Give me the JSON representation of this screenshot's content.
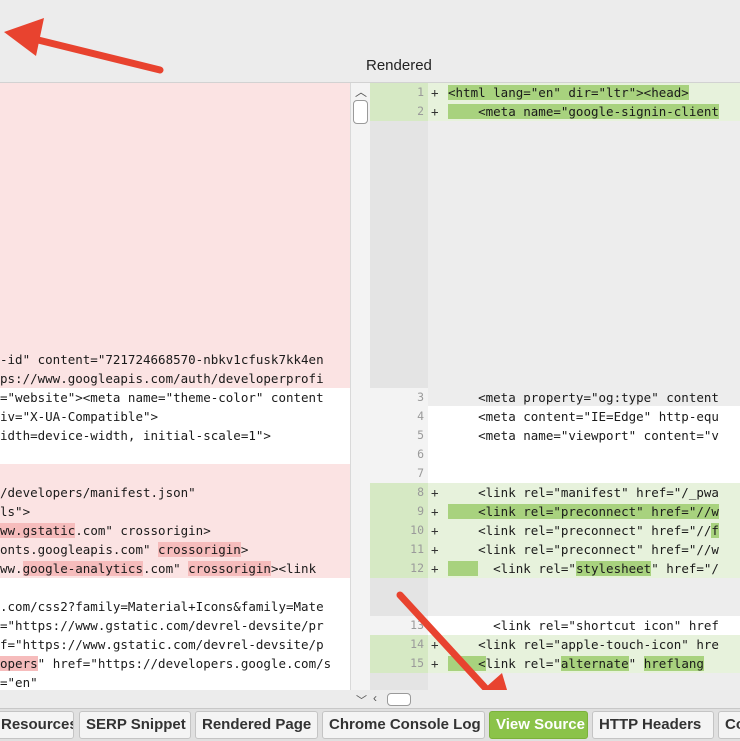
{
  "header": {
    "title": "Rendered"
  },
  "left_lines": [
    {
      "text": "-id\" content=\"721724668570-nbkv1cfusk7kk4en"
    },
    {
      "text": "ps://www.googleapis.com/auth/developerprofi"
    },
    {
      "text": "=\"website\"><meta name=\"theme-color\" content"
    },
    {
      "text": "iv=\"X-UA-Compatible\">"
    },
    {
      "text": "idth=device-width, initial-scale=1\">"
    },
    {
      "text": "/developers/manifest.json\""
    },
    {
      "text": "ls\">"
    },
    {
      "a": "",
      "h": "ww.gstatic",
      "b": ".com\" crossorigin>"
    },
    {
      "a": "onts.googleapis.com\" ",
      "h": "crossorigin",
      "b": ">"
    },
    {
      "a": "ww.",
      "h": "google-analytics",
      "b": ".com\" ",
      "h2": "crossorigin",
      "c": "><link"
    },
    {
      "text": ".com/css2?family=Material+Icons&family=Mate"
    },
    {
      "text": "=\"https://www.gstatic.com/devrel-devsite/pr"
    },
    {
      "text": "f=\"https://www.gstatic.com/devrel-devsite/p"
    },
    {
      "a": "",
      "h": "opers",
      "b": "\" href=\"https://developers.google.com/s"
    },
    {
      "text": "=\"en\""
    }
  ],
  "right_lines": [
    {
      "num": "1",
      "plus": "+",
      "pre": "",
      "h": "<html lang=\"en\" dir=\"ltr\"><head>",
      "post": ""
    },
    {
      "num": "2",
      "plus": "+",
      "pre": "",
      "h": "    <meta name=\"google-signin-client",
      "post": ""
    },
    {
      "num": "3",
      "plus": "",
      "pre": "    <meta property=\"og:type\" content",
      "h": "",
      "post": ""
    },
    {
      "num": "4",
      "plus": "",
      "pre": "    <meta content=\"IE=Edge\" http-equ",
      "h": "",
      "post": ""
    },
    {
      "num": "5",
      "plus": "",
      "pre": "    <meta name=\"viewport\" content=\"v",
      "h": "",
      "post": ""
    },
    {
      "num": "6",
      "plus": "",
      "pre": "",
      "h": "",
      "post": ""
    },
    {
      "num": "7",
      "plus": "",
      "pre": "",
      "h": "",
      "post": ""
    },
    {
      "num": "8",
      "plus": "+",
      "pre": "    <link rel=\"manifest\" href=\"/_pwa",
      "h": "",
      "post": ""
    },
    {
      "num": "9",
      "plus": "+",
      "pre": "",
      "h": "    <link rel=\"preconnect\" href=\"//w",
      "post": ""
    },
    {
      "num": "10",
      "plus": "+",
      "pre": "    <link rel=\"preconnect\" href=\"//",
      "h": "f",
      "post": ""
    },
    {
      "num": "11",
      "plus": "+",
      "pre": "    <link rel=\"preconnect\" href=\"//w",
      "h": "",
      "post": ""
    },
    {
      "num": "12",
      "plus": "+",
      "pre": "",
      "h": "    ",
      "post": "  <link rel=\"",
      "h2": "stylesheet",
      "post2": "\" href=\"/"
    },
    {
      "num": "13",
      "plus": "",
      "pre": "      <link rel=\"shortcut icon\" href",
      "h": "",
      "post": ""
    },
    {
      "num": "14",
      "plus": "+",
      "pre": "    <link rel=\"apple-touch-icon\" hre",
      "h": "",
      "post": ""
    },
    {
      "num": "15",
      "plus": "+",
      "pre": "",
      "h": "    <",
      "post": "link rel=\"",
      "h2": "alternate",
      "post2": "\" ",
      "h3": "hreflang"
    }
  ],
  "tabs": [
    {
      "label": "Resources",
      "active": false
    },
    {
      "label": "SERP Snippet",
      "active": false
    },
    {
      "label": "Rendered Page",
      "active": false
    },
    {
      "label": "Chrome Console Log",
      "active": false
    },
    {
      "label": "View Source",
      "active": true
    },
    {
      "label": "HTTP Headers",
      "active": false
    },
    {
      "label": "Co",
      "active": false
    }
  ],
  "colors": {
    "removed_bg": "#fbe3e3",
    "added_bg": "#e7f2dc",
    "accent_green": "#8bc34a",
    "arrow_red": "#e8432f"
  },
  "icons": {
    "scroll_up": "chevron-up-icon",
    "scroll_down": "chevron-down-icon",
    "scroll_left": "chevron-left-icon"
  }
}
